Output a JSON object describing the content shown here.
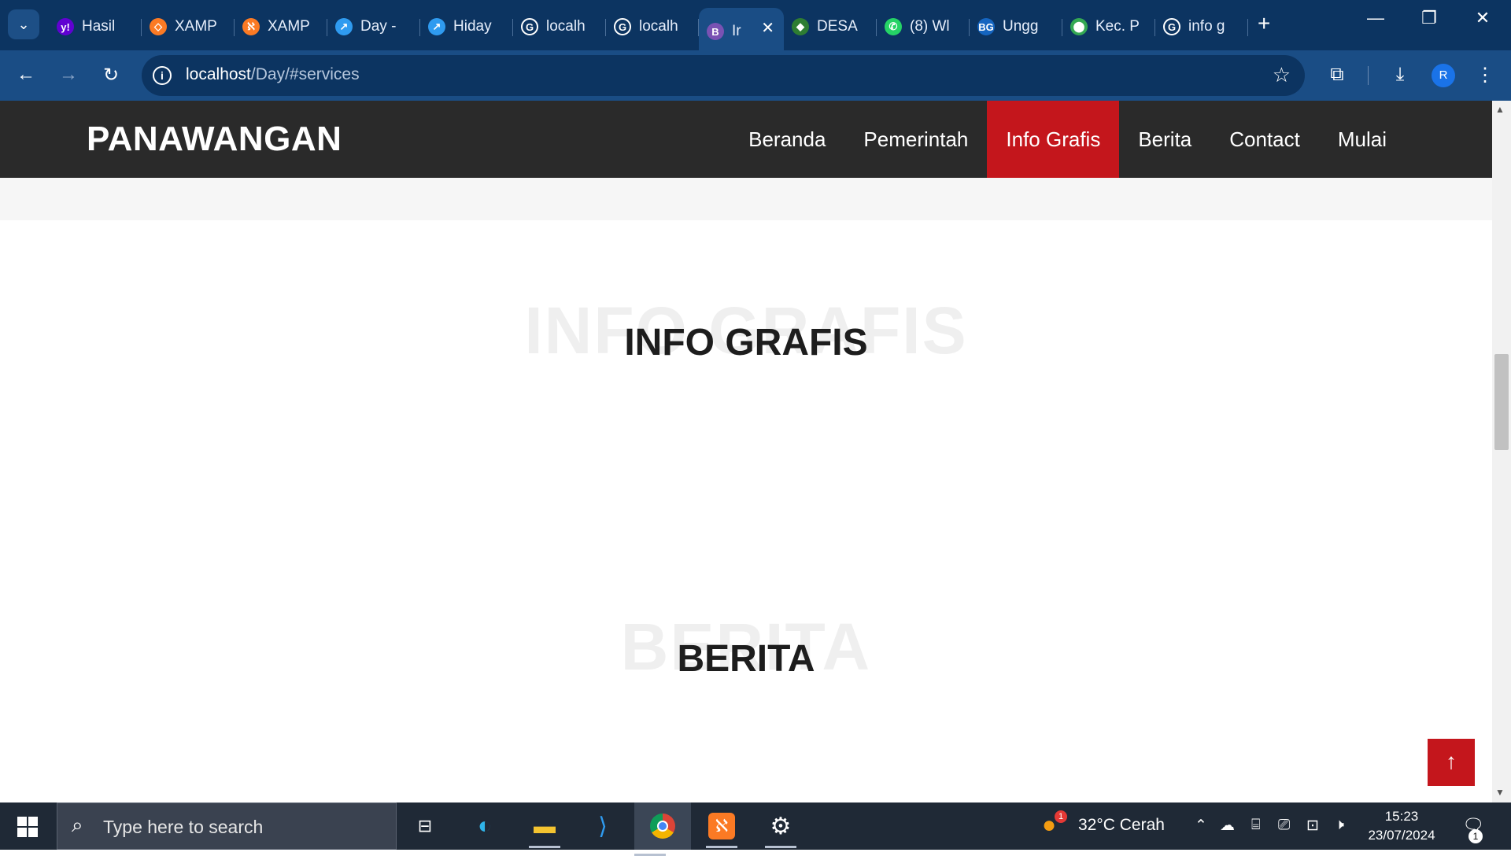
{
  "browser": {
    "tabs": [
      {
        "title": "Hasil",
        "favicon": "yahoo-icon",
        "color": "#6001d2",
        "glyph": "y!"
      },
      {
        "title": "XAMP",
        "favicon": "xampp-diamond-icon",
        "color": "#fb7a24",
        "glyph": "◇"
      },
      {
        "title": "XAMP",
        "favicon": "xampp-icon",
        "color": "#fb7a24",
        "glyph": "ℵ"
      },
      {
        "title": "Day -",
        "favicon": "hosting-icon",
        "color": "#2f9bf0",
        "glyph": "↗"
      },
      {
        "title": "Hiday",
        "favicon": "hosting-icon",
        "color": "#2f9bf0",
        "glyph": "↗"
      },
      {
        "title": "localh",
        "favicon": "google-icon",
        "color": "#ffffff",
        "glyph": "G"
      },
      {
        "title": "localh",
        "favicon": "google-icon",
        "color": "#ffffff",
        "glyph": "G"
      },
      {
        "title": "Ir",
        "favicon": "bootstrap-icon",
        "color": "#7952b3",
        "glyph": "B",
        "active": true
      },
      {
        "title": "DESA",
        "favicon": "emblem-icon",
        "color": "#2e7d32",
        "glyph": "◆"
      },
      {
        "title": "(8) Wl",
        "favicon": "whatsapp-icon",
        "color": "#25d366",
        "glyph": "✆"
      },
      {
        "title": "Ungg",
        "favicon": "bg-icon",
        "color": "#1565c0",
        "glyph": "BG"
      },
      {
        "title": "Kec. P",
        "favicon": "maps-icon",
        "color": "#34a853",
        "glyph": "⬤"
      },
      {
        "title": "info g",
        "favicon": "google-icon",
        "color": "#ffffff",
        "glyph": "G"
      }
    ],
    "url_host": "localhost",
    "url_path": "/Day/#services",
    "profile_initial": "R"
  },
  "site": {
    "brand": "PANAWANGAN",
    "nav": [
      {
        "label": "Beranda"
      },
      {
        "label": "Pemerintah"
      },
      {
        "label": "Info Grafis",
        "active": true
      },
      {
        "label": "Berita"
      },
      {
        "label": "Contact"
      },
      {
        "label": "Mulai"
      }
    ],
    "sections": {
      "info_grafis": {
        "bg": "INFO GRAFIS",
        "title": "INFO GRAFIS"
      },
      "berita": {
        "bg": "BERITA",
        "title": "BERITA"
      }
    },
    "accent": "#c4161c",
    "header_bg": "#2a2a2a"
  },
  "taskbar": {
    "search_placeholder": "Type here to search",
    "weather": "32°C  Cerah",
    "weather_badge": "1",
    "time": "15:23",
    "date": "23/07/2024",
    "notifications": "1"
  }
}
